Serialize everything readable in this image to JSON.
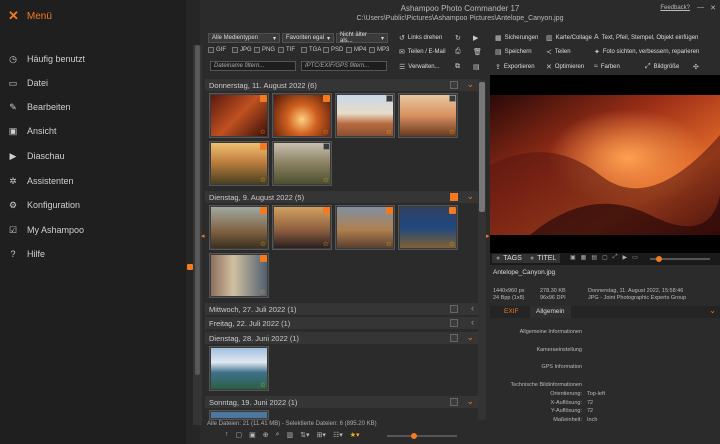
{
  "app": {
    "title": "Ashampoo Photo Commander 17",
    "path": "C:\\Users\\Public\\Pictures\\Ashampoo Pictures\\Antelope_Canyon.jpg",
    "feedback": "Feedback?"
  },
  "sidebar": {
    "menu_label": "Menü",
    "items": [
      {
        "label": "Häufig benutzt",
        "icon": "clock-icon"
      },
      {
        "label": "Datei",
        "icon": "file-icon"
      },
      {
        "label": "Bearbeiten",
        "icon": "pencil-icon"
      },
      {
        "label": "Ansicht",
        "icon": "view-icon"
      },
      {
        "label": "Diaschau",
        "icon": "slideshow-icon"
      },
      {
        "label": "Assistenten",
        "icon": "wand-icon"
      },
      {
        "label": "Konfiguration",
        "icon": "gear-icon"
      },
      {
        "label": "My Ashampoo",
        "icon": "account-icon"
      },
      {
        "label": "Hilfe",
        "icon": "help-icon"
      }
    ]
  },
  "filters": {
    "media": "Alle Medientypen",
    "favorites": "Favoriten egal",
    "age": "Nicht älter als...",
    "types": [
      "GIF",
      "JPG",
      "PNG",
      "TIF",
      "TGA",
      "PSD",
      "MP4",
      "MP3"
    ],
    "filename_placeholder": "Dateiname filtern...",
    "exif_placeholder": "IPTC/EXIF/GPS filtern..."
  },
  "toolbar": {
    "rotate_left": "Links drehen",
    "share": "Teilen / E-Mail",
    "manage": "Verwalten...",
    "backups": "Sicherungen",
    "save": "Speichern",
    "export": "Exportieren",
    "card": "Karte/Collage",
    "split": "Teilen",
    "optimize": "Optimieren",
    "text": "Text, Pfeil, Stempel, Objekt einfügen",
    "photo": "Foto sichten, verbessern, reparieren",
    "colors": "Farben",
    "size": "Bildgröße"
  },
  "groups": [
    {
      "label": "Donnerstag, 11. August 2022 (6)",
      "checked": false
    },
    {
      "label": "Dienstag, 9. August 2022 (5)",
      "checked": true
    },
    {
      "label": "Mittwoch, 27. Juli 2022 (1)",
      "checked": false
    },
    {
      "label": "Freitag, 22. Juli 2022 (1)",
      "checked": false
    },
    {
      "label": "Dienstag, 28. Juni 2022 (1)",
      "checked": false
    },
    {
      "label": "Sonntag, 19. Juni 2022 (1)",
      "checked": false
    }
  ],
  "status": {
    "text": "Alle Dateien: 21 (11.41 MB) - Selektierte Dateien: 6 (895.20 KB)"
  },
  "tabs": {
    "tags": "TAGS",
    "title": "TITEL"
  },
  "file": {
    "name": "Antelope_Canyon.jpg",
    "dims": "1440x960 px",
    "size": "278.30 KB",
    "bpp": "24 Bpp (1x8)",
    "dpi": "96x96 DPI",
    "date": "Donnerstag, 11. August 2022, 15:58:46",
    "format": "JPG - Joint Photographic Experts Group"
  },
  "info_tabs": {
    "exif": "EXIF",
    "general": "Allgemein"
  },
  "info": {
    "general": "Allgemeine Informationen",
    "camera": "Kameraeinstellung",
    "gps": "GPS Information",
    "tech": "Technische Bildinformationen",
    "orientation_k": "Orientierung:",
    "orientation_v": "Top-left",
    "xres_k": "X-Auflösung:",
    "xres_v": "72",
    "yres_k": "Y-Auflösung:",
    "yres_v": "72",
    "unit_k": "Maßeinheit:",
    "unit_v": "Inch"
  },
  "colors": {
    "accent": "#f47a20",
    "panel": "#2b2b2b",
    "sidebar": "#1f1f1f"
  }
}
